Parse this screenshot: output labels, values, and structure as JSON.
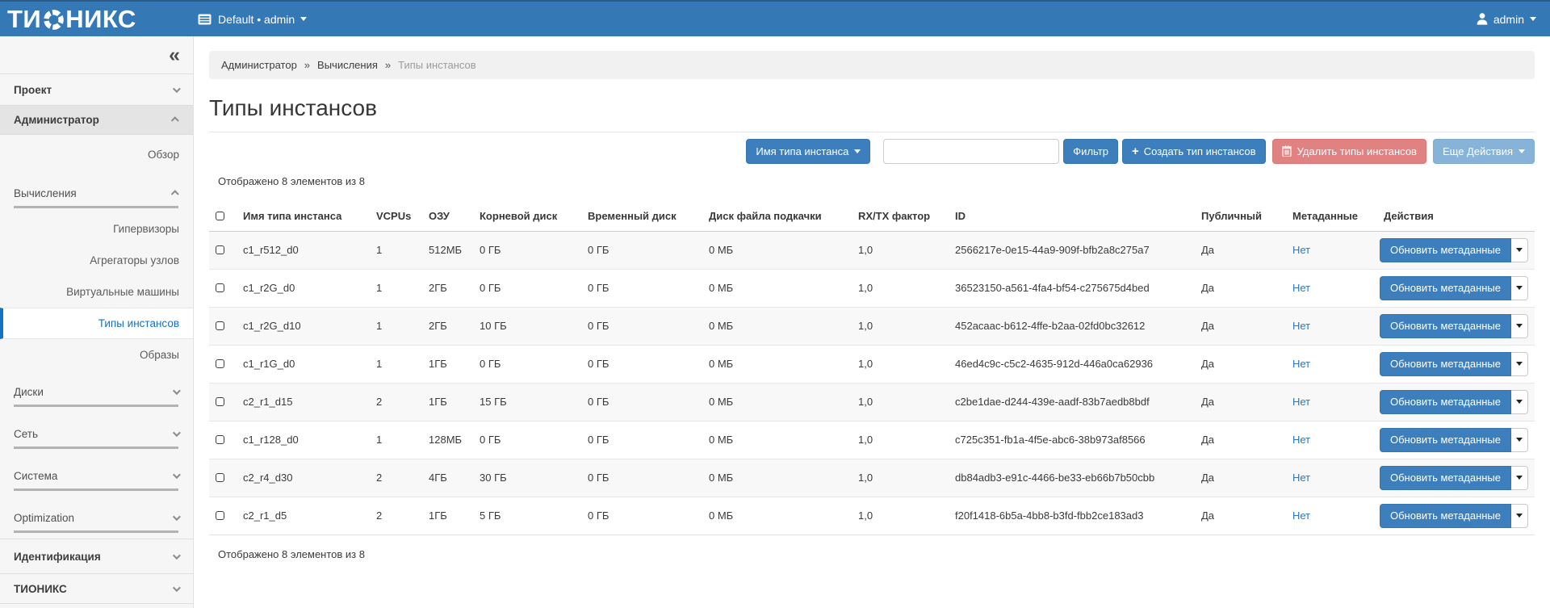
{
  "navbar": {
    "brand_left": "ТИ",
    "brand_right": "НИКС",
    "context_label": "Default • admin",
    "user_label": "admin"
  },
  "sidebar": {
    "collapse_glyph": "«",
    "project": "Проект",
    "admin": "Администратор",
    "overview": "Обзор",
    "compute_group": "Вычисления",
    "compute_items": {
      "hypervisors": "Гипервизоры",
      "aggregates": "Агрегаторы узлов",
      "instances": "Виртуальные машины",
      "flavors": "Типы инстансов",
      "images": "Образы"
    },
    "volumes_group": "Диски",
    "network_group": "Сеть",
    "system_group": "Система",
    "optimization_group": "Optimization",
    "identity": "Идентификация",
    "tionix": "ТИОНИКС"
  },
  "breadcrumb": {
    "items": [
      "Администратор",
      "Вычисления"
    ],
    "separator": "»",
    "current": "Типы инстансов"
  },
  "page": {
    "title": "Типы инстансов"
  },
  "toolbar": {
    "filter_field_label": "Имя типа инстанса",
    "search_value": "",
    "filter_button": "Фильтр",
    "create_button": "Создать тип инстансов",
    "delete_button": "Удалить типы инстансов",
    "more_button": "Еще Действия"
  },
  "table": {
    "caption_top": "Отображено 8 элементов из 8",
    "caption_bottom": "Отображено 8 элементов из 8",
    "columns": [
      "Имя типа инстанса",
      "VCPUs",
      "ОЗУ",
      "Корневой диск",
      "Временный диск",
      "Диск файла подкачки",
      "RX/TX фактор",
      "ID",
      "Публичный",
      "Метаданные",
      "Действия"
    ],
    "row_action_label": "Обновить метаданные",
    "rows": [
      {
        "name": "c1_r512_d0",
        "vcpus": "1",
        "ram": "512МБ",
        "root": "0 ГБ",
        "ephemeral": "0 ГБ",
        "swap": "0 МБ",
        "rxtx": "1,0",
        "id": "2566217e-0e15-44a9-909f-bfb2a8c275a7",
        "public": "Да",
        "metadata": "Нет"
      },
      {
        "name": "c1_r2G_d0",
        "vcpus": "1",
        "ram": "2ГБ",
        "root": "0 ГБ",
        "ephemeral": "0 ГБ",
        "swap": "0 МБ",
        "rxtx": "1,0",
        "id": "36523150-a561-4fa4-bf54-c275675d4bed",
        "public": "Да",
        "metadata": "Нет"
      },
      {
        "name": "c1_r2G_d10",
        "vcpus": "1",
        "ram": "2ГБ",
        "root": "10 ГБ",
        "ephemeral": "0 ГБ",
        "swap": "0 МБ",
        "rxtx": "1,0",
        "id": "452acaac-b612-4ffe-b2aa-02fd0bc32612",
        "public": "Да",
        "metadata": "Нет"
      },
      {
        "name": "c1_r1G_d0",
        "vcpus": "1",
        "ram": "1ГБ",
        "root": "0 ГБ",
        "ephemeral": "0 ГБ",
        "swap": "0 МБ",
        "rxtx": "1,0",
        "id": "46ed4c9c-c5c2-4635-912d-446a0ca62936",
        "public": "Да",
        "metadata": "Нет"
      },
      {
        "name": "c2_r1_d15",
        "vcpus": "2",
        "ram": "1ГБ",
        "root": "15 ГБ",
        "ephemeral": "0 ГБ",
        "swap": "0 МБ",
        "rxtx": "1,0",
        "id": "c2be1dae-d244-439e-aadf-83b7aedb8bdf",
        "public": "Да",
        "metadata": "Нет"
      },
      {
        "name": "c1_r128_d0",
        "vcpus": "1",
        "ram": "128МБ",
        "root": "0 ГБ",
        "ephemeral": "0 ГБ",
        "swap": "0 МБ",
        "rxtx": "1,0",
        "id": "c725c351-fb1a-4f5e-abc6-38b973af8566",
        "public": "Да",
        "metadata": "Нет"
      },
      {
        "name": "c2_r4_d30",
        "vcpus": "2",
        "ram": "4ГБ",
        "root": "30 ГБ",
        "ephemeral": "0 ГБ",
        "swap": "0 МБ",
        "rxtx": "1,0",
        "id": "db84adb3-e91c-4466-be33-eb66b7b50cbb",
        "public": "Да",
        "metadata": "Нет"
      },
      {
        "name": "c2_r1_d5",
        "vcpus": "2",
        "ram": "1ГБ",
        "root": "5 ГБ",
        "ephemeral": "0 ГБ",
        "swap": "0 МБ",
        "rxtx": "1,0",
        "id": "f20f1418-6b5a-4bb8-b3fd-fbb2ce183ad3",
        "public": "Да",
        "metadata": "Нет"
      }
    ]
  }
}
